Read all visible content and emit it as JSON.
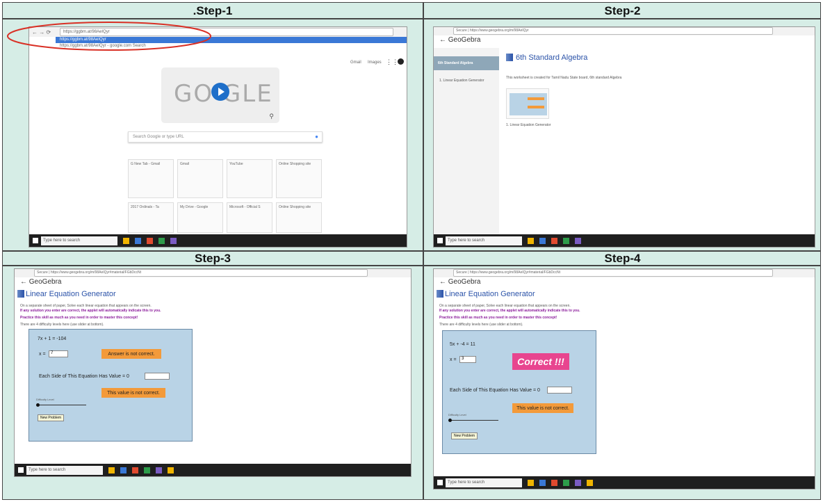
{
  "steps": [
    {
      "title": ".Step-1"
    },
    {
      "title": "Step-2"
    },
    {
      "title": "Step-3"
    },
    {
      "title": "Step-4"
    }
  ],
  "step1": {
    "url": "https://ggbm.at/98AeIQyr",
    "suggest1": "https://ggbm.at/98AeIQyr",
    "suggest2": "https://ggbm.at/98AeIQyr - google.com Search",
    "top_links": [
      "Gmail",
      "Images"
    ],
    "doodle": "GO GLE",
    "search_placeholder": "Search Google or type URL",
    "tiles": [
      "G New Tab - Gmail",
      "Gmail",
      "YouTube",
      "Online Shopping site",
      "2017 Ordinals - Ta",
      "My Drive - Google",
      "Microsoft - Official S",
      "Online Shopping site"
    ],
    "taskbar_search": "Type here to search",
    "accent": "#d93025"
  },
  "step2": {
    "url": "Secure | https://www.geogebra.org/m/98AeIQyr",
    "app": "GeoGebra",
    "side_title": "6th Standard Algebra",
    "side_item": "1. Linear Equation Generator",
    "main_title": "6th Standard Algebra",
    "desc": "This worksheet is created for Tamil Nadu State board, 6th standard Algebra",
    "card_caption": "1. Linear Equation Generator",
    "taskbar_search": "Type here to search"
  },
  "step3": {
    "url": "Secure | https://www.geogebra.org/m/98AeIQyr#material/FGbDccNt",
    "app": "GeoGebra",
    "title": "Linear Equation Generator",
    "line1": "On a separate sheet of paper, Solve each linear equation that appears on the screen.",
    "line2": "If any solution you enter are correct, the applet will automatically indicate this to you.",
    "line3": "Practice this skill as much as you need in order to master this concept!",
    "line4": "There are 4 difficulty levels here (use slider at bottom).",
    "equation": "7x + 1 = -104",
    "x_label": "x =",
    "x_value": "7",
    "answer_msg": "Answer is not correct.",
    "each_side": "Each Side of This Equation Has Value = 0",
    "value_msg": "This value is not correct.",
    "difficulty": "Difficulty Level",
    "new_problem": "New Problem",
    "taskbar_search": "Type here to search"
  },
  "step4": {
    "url": "Secure | https://www.geogebra.org/m/98AeIQyr#material/FGbDccNt",
    "app": "GeoGebra",
    "title": "Linear Equation Generator",
    "line1": "On a separate sheet of paper, Solve each linear equation that appears on the screen.",
    "line2": "If any solution you enter are correct, the applet will automatically indicate this to you.",
    "line3": "Practice this skill as much as you need in order to master this concept!",
    "line4": "There are 4 difficulty levels here (use slider at bottom).",
    "equation": "5x + -4 = 11",
    "x_label": "x =",
    "x_value": "3",
    "correct_msg": "Correct !!!",
    "each_side": "Each Side of This Equation Has Value = 0",
    "value_msg": "This value is not correct.",
    "difficulty": "Difficulty Level",
    "new_problem": "New Problem",
    "taskbar_search": "Type here to search"
  }
}
